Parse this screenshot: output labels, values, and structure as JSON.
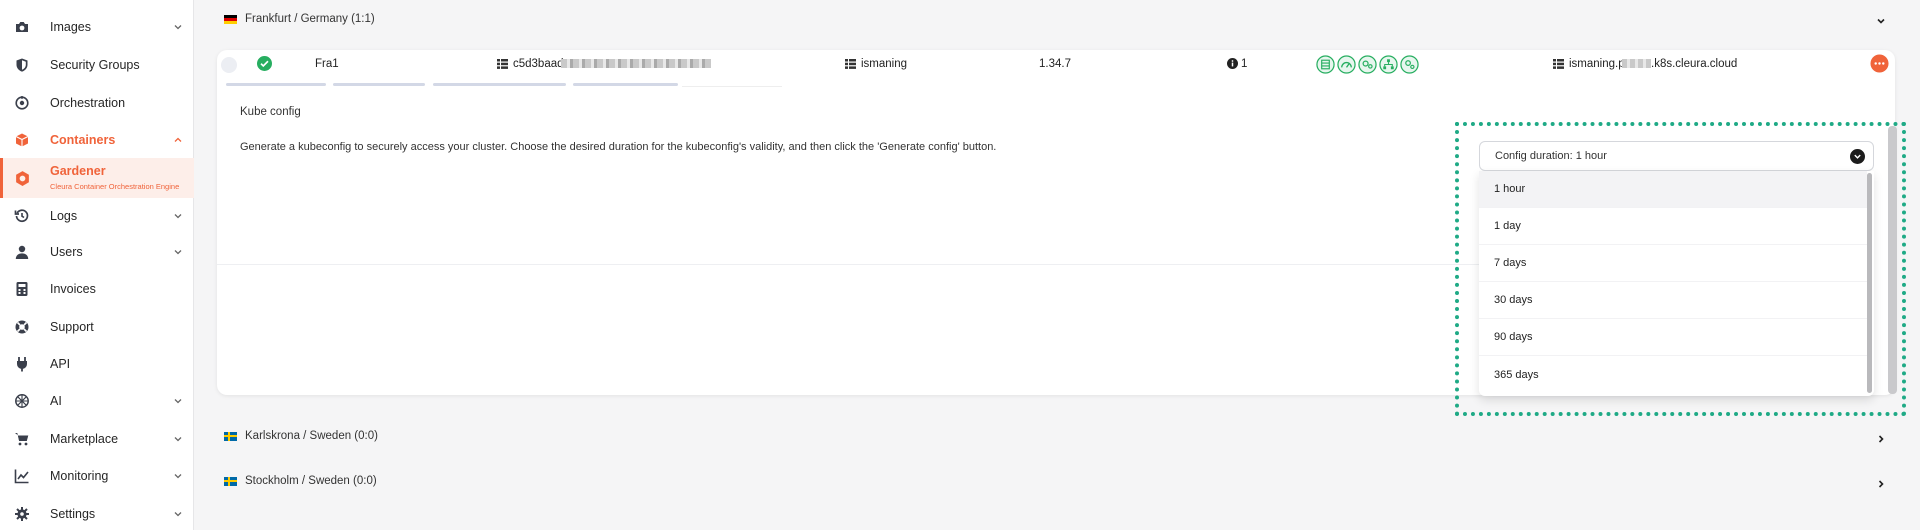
{
  "sidebar": {
    "items": [
      {
        "label": "Images",
        "icon": "camera-icon",
        "chevron": "down"
      },
      {
        "label": "Security Groups",
        "icon": "shield-icon",
        "chevron": ""
      },
      {
        "label": "Orchestration",
        "icon": "orchestration-icon",
        "chevron": ""
      },
      {
        "label": "Containers",
        "icon": "cube-icon",
        "chevron": "up"
      },
      {
        "label": "Gardener",
        "sublabel": "Cleura Container Orchestration Engine",
        "icon": "gardener-icon"
      },
      {
        "label": "Logs",
        "icon": "history-icon",
        "chevron": "down"
      },
      {
        "label": "Users",
        "icon": "user-icon",
        "chevron": "down"
      },
      {
        "label": "Invoices",
        "icon": "calculator-icon",
        "chevron": ""
      },
      {
        "label": "Support",
        "icon": "lifebuoy-icon",
        "chevron": ""
      },
      {
        "label": "API",
        "icon": "plug-icon",
        "chevron": ""
      },
      {
        "label": "AI",
        "icon": "ai-icon",
        "chevron": "down"
      },
      {
        "label": "Marketplace",
        "icon": "cart-icon",
        "chevron": "down"
      },
      {
        "label": "Monitoring",
        "icon": "chart-line-icon",
        "chevron": "down"
      },
      {
        "label": "Settings",
        "icon": "gear-icon",
        "chevron": "down"
      }
    ]
  },
  "regions": {
    "frankfurt": "Frankfurt / Germany (1:1)",
    "karlskrona": "Karlskrona / Sweden (0:0)",
    "stockholm": "Stockholm / Sweden (0:0)"
  },
  "cluster": {
    "name": "Fra1",
    "id": "c5d3baad",
    "project": "ismaning",
    "version": "1.34.7",
    "info_count": "1",
    "endpoint_prefix": "ismaning.p",
    "endpoint_suffix": ".k8s.cleura.cloud",
    "status_color": "#27ae60"
  },
  "kubeconfig": {
    "title": "Kube config",
    "description": "Generate a kubeconfig to securely access your cluster. Choose the desired duration for the kubeconfig's validity, and then click the 'Generate config' button.",
    "select_label": "Config duration: 1 hour",
    "options": [
      "1 hour",
      "1 day",
      "7 days",
      "30 days",
      "90 days",
      "365 days"
    ],
    "selected": "1 hour"
  },
  "colors": {
    "accent": "#f0633a",
    "highlight": "#1faa86",
    "status_green": "#27ae60"
  }
}
